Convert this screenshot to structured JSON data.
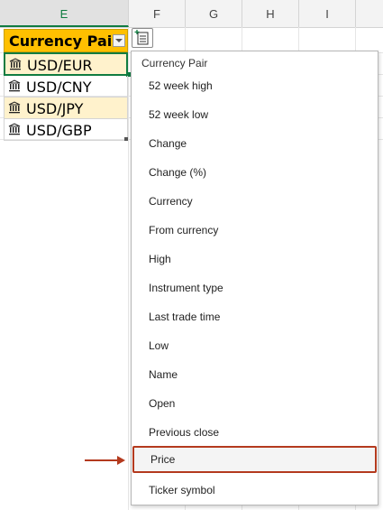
{
  "columns": [
    "E",
    "F",
    "G",
    "H",
    "I"
  ],
  "table": {
    "header": "Currency Pair",
    "rows": [
      "USD/EUR",
      "USD/CNY",
      "USD/JPY",
      "USD/GBP"
    ]
  },
  "dropdown": {
    "title": "Currency Pair",
    "items": [
      "52 week high",
      "52 week low",
      "Change",
      "Change (%)",
      "Currency",
      "From currency",
      "High",
      "Instrument type",
      "Last trade time",
      "Low",
      "Name",
      "Open",
      "Previous close",
      "Price",
      "Ticker symbol"
    ],
    "highlighted": "Price"
  },
  "colors": {
    "header_fill": "#ffc000",
    "band_fill": "#fff2cc",
    "selection": "#107c41",
    "arrow": "#b43a1e"
  },
  "icons": [
    "bank-icon",
    "insert-data-icon",
    "filter-dropdown-icon",
    "arrow-icon"
  ]
}
